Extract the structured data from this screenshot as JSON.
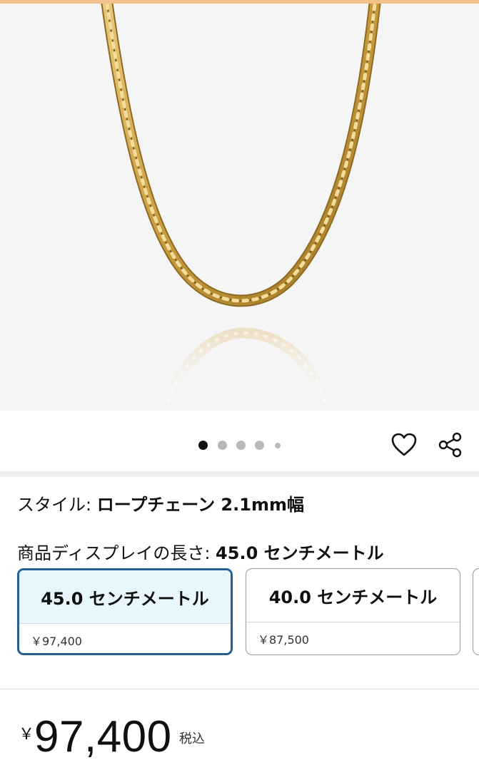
{
  "gallery": {
    "image_alt": "ロープチェーン ネックレス",
    "page_count": 5,
    "active_index": 0
  },
  "actions": {
    "wishlist_icon": "heart-outline-icon",
    "share_icon": "share-icon"
  },
  "style": {
    "label": "スタイル: ",
    "value": "ロープチェーン 2.1mm幅"
  },
  "size": {
    "label": "商品ディスプレイの長さ: ",
    "value": "45.0 センチメートル",
    "options": [
      {
        "label": "45.0 センチメートル",
        "price": "￥97,400",
        "selected": true
      },
      {
        "label": "40.0 センチメートル",
        "price": "￥87,500",
        "selected": false
      }
    ]
  },
  "price": {
    "currency": "￥",
    "amount": "97,400",
    "tax_note": "税込"
  },
  "colors": {
    "accent_selected_border": "#245f94",
    "selected_bg": "#e8f7fd",
    "gold": "#c9a13f"
  }
}
